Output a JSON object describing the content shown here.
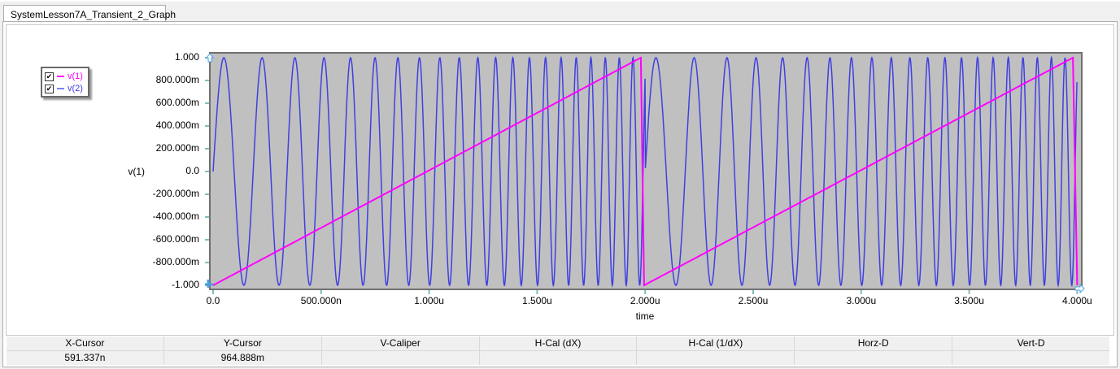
{
  "tab": {
    "label": "SystemLesson7A_Transient_2_Graph"
  },
  "legend": [
    {
      "label": "v(1)",
      "checked": true,
      "color": "#ff00ff"
    },
    {
      "label": "v(2)",
      "checked": true,
      "color": "#4040e0"
    }
  ],
  "chart_data": {
    "type": "line",
    "xlabel": "time",
    "ylabel": "v(1)",
    "xlim": [
      0,
      4.0
    ],
    "x_unit": "us",
    "ylim": [
      -1,
      1
    ],
    "x_ticks": [
      "0.0",
      "500.000n",
      "1.000u",
      "1.500u",
      "2.000u",
      "2.500u",
      "3.000u",
      "3.500u",
      "4.000u"
    ],
    "y_ticks": [
      "1.000",
      "800.000m",
      "600.000m",
      "400.000m",
      "200.000m",
      "0.0",
      "-200.000m",
      "-400.000m",
      "-600.000m",
      "-800.000m",
      "-1.000"
    ],
    "background": "#c0c0c0",
    "series": [
      {
        "name": "v(1)",
        "color": "#ff00ff",
        "kind": "sawtooth",
        "points": [
          [
            0,
            -1
          ],
          [
            1.98,
            1
          ],
          [
            1.995,
            -1
          ],
          [
            3.98,
            1
          ],
          [
            4.0,
            -1
          ]
        ]
      },
      {
        "name": "v(2)",
        "color": "#4040e0",
        "kind": "chirp-sine",
        "amplitude": 1,
        "start_freq_MHz": 4.86,
        "chirp_rate_MHz_per_us": 5.72,
        "repeat_period_us": 2.0
      }
    ]
  },
  "cursor_table": {
    "headers": [
      "X-Cursor",
      "Y-Cursor",
      "V-Caliper",
      "H-Cal (dX)",
      "H-Cal (1/dX)",
      "Horz-D",
      "Vert-D"
    ],
    "values": [
      "591.337n",
      "964.888m",
      "",
      "",
      "",
      "",
      ""
    ]
  }
}
